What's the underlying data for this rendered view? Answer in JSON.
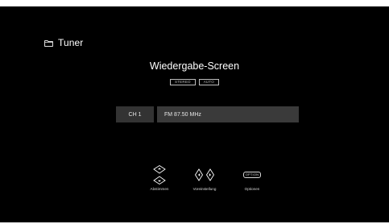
{
  "source": {
    "label": "Tuner",
    "icon": "folder-icon"
  },
  "screen": {
    "title": "Wiedergabe-Screen"
  },
  "badges": [
    "STEREO",
    "AUTO"
  ],
  "channel": {
    "label": "CH 1",
    "frequency": "FM 87.50 MHz"
  },
  "controls": {
    "tune": {
      "label": "Abstimmen",
      "icon": "up-down-arrows-icon"
    },
    "preset": {
      "label": "Voreinstellung",
      "icon": "left-right-arrows-icon"
    },
    "options": {
      "label": "Optionen",
      "button_text": "OPTION"
    }
  },
  "colors": {
    "background": "#000000",
    "bar": "#3a3a3a",
    "text": "#ffffff"
  }
}
